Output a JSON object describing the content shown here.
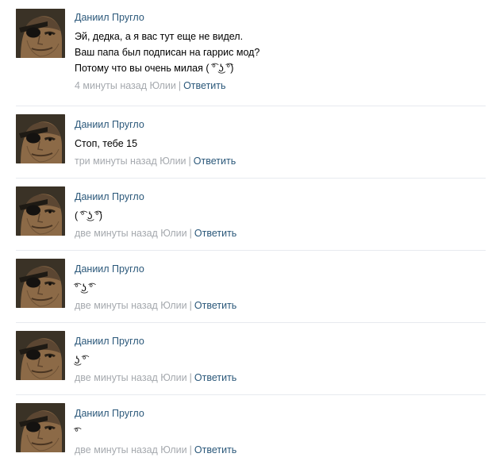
{
  "colors": {
    "author_link": "#2b587a",
    "meta_text": "#a5a9ae",
    "divider": "#e7eaef"
  },
  "comments": [
    {
      "author": "Даниил Пругло",
      "lines": [
        "Эй, дедка, а я вас тут еще не видел.",
        "Ваш папа был подписан на гаррис мод?",
        "Потому что вы очень милая ( ͡° ͜ʖ ͡°)"
      ],
      "time": "4 минуты назад Юлии",
      "separator": "|",
      "reply": "Ответить",
      "avatar_icon": "soldier-eyepatch-avatar"
    },
    {
      "author": "Даниил Пругло",
      "lines": [
        "Стоп, тебе 15"
      ],
      "time": "три минуты назад Юлии",
      "separator": "|",
      "reply": "Ответить",
      "avatar_icon": "soldier-eyepatch-avatar"
    },
    {
      "author": "Даниил Пругло",
      "lines": [
        "( ͡° ͜ʖ ͡°)"
      ],
      "time": "две минуты назад Юлии",
      "separator": "|",
      "reply": "Ответить",
      "avatar_icon": "soldier-eyepatch-avatar"
    },
    {
      "author": "Даниил Пругло",
      "lines": [
        "͡° ͜ʖ ͡°"
      ],
      "time": "две минуты назад Юлии",
      "separator": "|",
      "reply": "Ответить",
      "avatar_icon": "soldier-eyepatch-avatar"
    },
    {
      "author": "Даниил Пругло",
      "lines": [
        "͜ʖ ͡°"
      ],
      "time": "две минуты назад Юлии",
      "separator": "|",
      "reply": "Ответить",
      "avatar_icon": "soldier-eyepatch-avatar"
    },
    {
      "author": "Даниил Пругло",
      "lines": [
        "͡°"
      ],
      "time": "две минуты назад Юлии",
      "separator": "|",
      "reply": "Ответить",
      "avatar_icon": "soldier-eyepatch-avatar"
    }
  ]
}
